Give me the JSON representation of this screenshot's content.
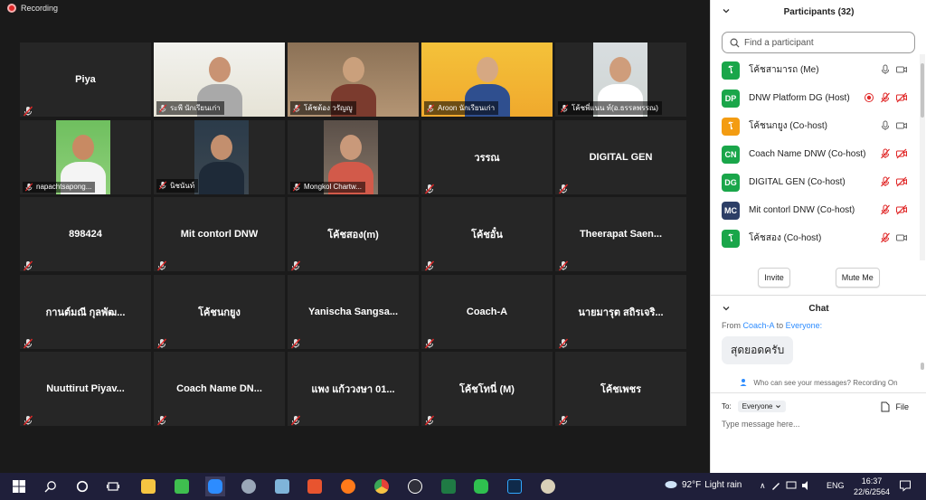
{
  "recording": {
    "label": "Recording",
    "color": "#e02828"
  },
  "tiles": [
    {
      "name": "Piya",
      "type": "name"
    },
    {
      "name": "ระพี นักเรียนเก่า",
      "type": "video"
    },
    {
      "name": "โค้ชต้อง วรัญญู",
      "type": "video"
    },
    {
      "name": "Aroon นักเรียนเก่า",
      "type": "video"
    },
    {
      "name": "โค้ชพี่แนน ท์(อ.ธรรลพรรณ)",
      "type": "video"
    },
    {
      "name": "napachtsapong...",
      "type": "video"
    },
    {
      "name": "นิชนันท์",
      "type": "video"
    },
    {
      "name": "Mongkol Chartw...",
      "type": "video"
    },
    {
      "name": "วรรณ",
      "type": "name"
    },
    {
      "name": "DIGITAL GEN",
      "type": "name"
    },
    {
      "name": "898424",
      "type": "name"
    },
    {
      "name": "Mit contorl DNW",
      "type": "name"
    },
    {
      "name": "โค้ชสอง(m)",
      "type": "name"
    },
    {
      "name": "โค้ชอั๋น",
      "type": "name"
    },
    {
      "name": "Theerapat  Saen...",
      "type": "name"
    },
    {
      "name": "กานต์มณี กุลพัฒ...",
      "type": "name"
    },
    {
      "name": "โค้ชนกยูง",
      "type": "name"
    },
    {
      "name": "Yanischa  Sangsa...",
      "type": "name"
    },
    {
      "name": "Coach-A",
      "type": "name"
    },
    {
      "name": "นายมารุต สถิรเจริ...",
      "type": "name"
    },
    {
      "name": "Nuuttirut  Piyav...",
      "type": "name"
    },
    {
      "name": "Coach  Name  DN...",
      "type": "name"
    },
    {
      "name": "แพง แก้ววงษา 01...",
      "type": "name"
    },
    {
      "name": "โค้ชโทนี่ (M)",
      "type": "name"
    },
    {
      "name": "โค้ชเพชร",
      "type": "name"
    }
  ],
  "participants": {
    "title": "Participants (32)",
    "search_placeholder": "Find a participant",
    "list": [
      {
        "initials": "โ",
        "name": "โค้ชสามารถ (Me)",
        "color": "#1aa64a",
        "mic": "on",
        "video": "on",
        "rec": false
      },
      {
        "initials": "DP",
        "name": "DNW Platform DG (Host)",
        "color": "#1aa64a",
        "mic": "off",
        "video": "off",
        "rec": true
      },
      {
        "initials": "โ",
        "name": "โค้ชนกยูง (Co-host)",
        "color": "#f39c12",
        "mic": "on",
        "video": "on",
        "rec": false
      },
      {
        "initials": "CN",
        "name": "Coach Name DNW (Co-host)",
        "color": "#1aa64a",
        "mic": "off",
        "video": "off",
        "rec": false
      },
      {
        "initials": "DG",
        "name": "DIGITAL GEN (Co-host)",
        "color": "#1aa64a",
        "mic": "off",
        "video": "off",
        "rec": false
      },
      {
        "initials": "MC",
        "name": "Mit contorl DNW (Co-host)",
        "color": "#2c3e66",
        "mic": "off",
        "video": "off",
        "rec": false
      },
      {
        "initials": "โ",
        "name": "โค้ชสอง (Co-host)",
        "color": "#1aa64a",
        "mic": "off",
        "video": "on",
        "rec": false
      }
    ],
    "invite_label": "Invite",
    "mute_me_label": "Mute Me"
  },
  "chat": {
    "title": "Chat",
    "from_prefix": "From",
    "from_name": "Coach-A",
    "to_word": "to",
    "to_name": "Everyone:",
    "message": "สุดยอดครับ",
    "who_can_see": "Who can see your messages? Recording On",
    "to_label": "To:",
    "to_value": "Everyone",
    "file_label": "File",
    "input_placeholder": "Type message here..."
  },
  "taskbar": {
    "weather_temp": "92°F",
    "weather_text": "Light rain",
    "lang": "ENG",
    "time": "16:37",
    "date": "22/6/2564"
  }
}
